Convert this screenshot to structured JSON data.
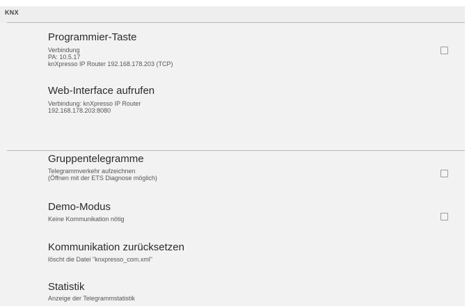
{
  "section": {
    "title": "KNX"
  },
  "items": [
    {
      "title": "Programmier-Taste",
      "subtitle": [
        "Verbindung",
        "PA: 10.5.17",
        "knXpresso IP Router  192.168.178.203 (TCP)"
      ],
      "checkbox": false
    },
    {
      "title": "Web-Interface aufrufen",
      "subtitle": [
        "Verbindung: knXpresso IP Router",
        "192.168.178.203:8080"
      ]
    },
    {
      "title": "Gruppentelegramme",
      "subtitle": [
        "Telegrammverkehr aufzeichnen",
        "(Öffnen mit der ETS Diagnose möglich)"
      ],
      "checkbox": false
    },
    {
      "title": "Demo-Modus",
      "subtitle": [
        "Keine Kommunikation nötig"
      ],
      "checkbox": false
    },
    {
      "title": "Kommunikation zurücksetzen",
      "subtitle": [
        "löscht die Datei \"knxpresso_com.xml\""
      ]
    },
    {
      "title": "Statistik",
      "subtitle": [
        "Anzeige der Telegrammstatistik"
      ]
    }
  ]
}
